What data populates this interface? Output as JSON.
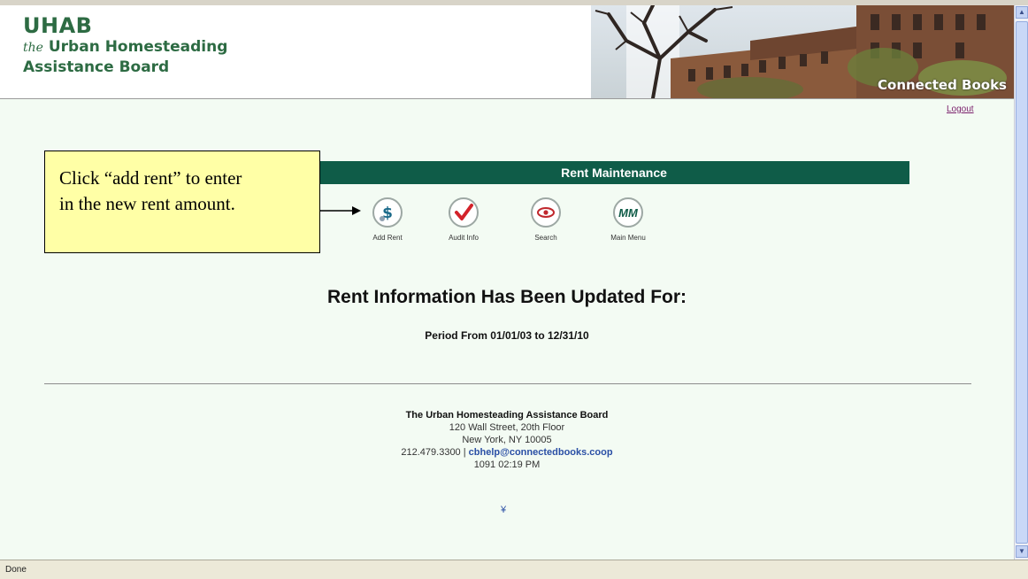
{
  "header": {
    "logo_uhab": "UHAB",
    "logo_the": "the",
    "logo_line1": "Urban Homesteading",
    "logo_line2": "Assistance Board",
    "photo_caption": "Connected Books"
  },
  "nav": {
    "logout": "Logout"
  },
  "section_title": "Rent Maintenance",
  "toolbar": [
    {
      "label": "Add Rent",
      "icon": "dollar-icon"
    },
    {
      "label": "Audit Info",
      "icon": "checkmark-icon"
    },
    {
      "label": "Search",
      "icon": "eye-icon"
    },
    {
      "label": "Main Menu",
      "icon": "mm-icon",
      "glyph": "MM"
    }
  ],
  "callout": {
    "line1": "Click “add rent” to enter",
    "line2": "in the new rent amount."
  },
  "main": {
    "headline": "Rent Information Has Been Updated For:",
    "period": "Period From 01/01/03 to 12/31/10"
  },
  "footer": {
    "org": "The Urban Homesteading Assistance Board",
    "street": "120 Wall Street, 20th Floor",
    "city": "New York, NY 10005",
    "phone": "212.479.3300",
    "separator": " | ",
    "email": "cbhelp@connectedbooks.coop",
    "meta": "1091  02:19 PM"
  },
  "status": {
    "text": "Done"
  },
  "colors": {
    "brand_green": "#2d6b43",
    "bar_green": "#0f5c48",
    "callout_yellow": "#ffffa6",
    "page_bg": "#f3fbf3"
  }
}
